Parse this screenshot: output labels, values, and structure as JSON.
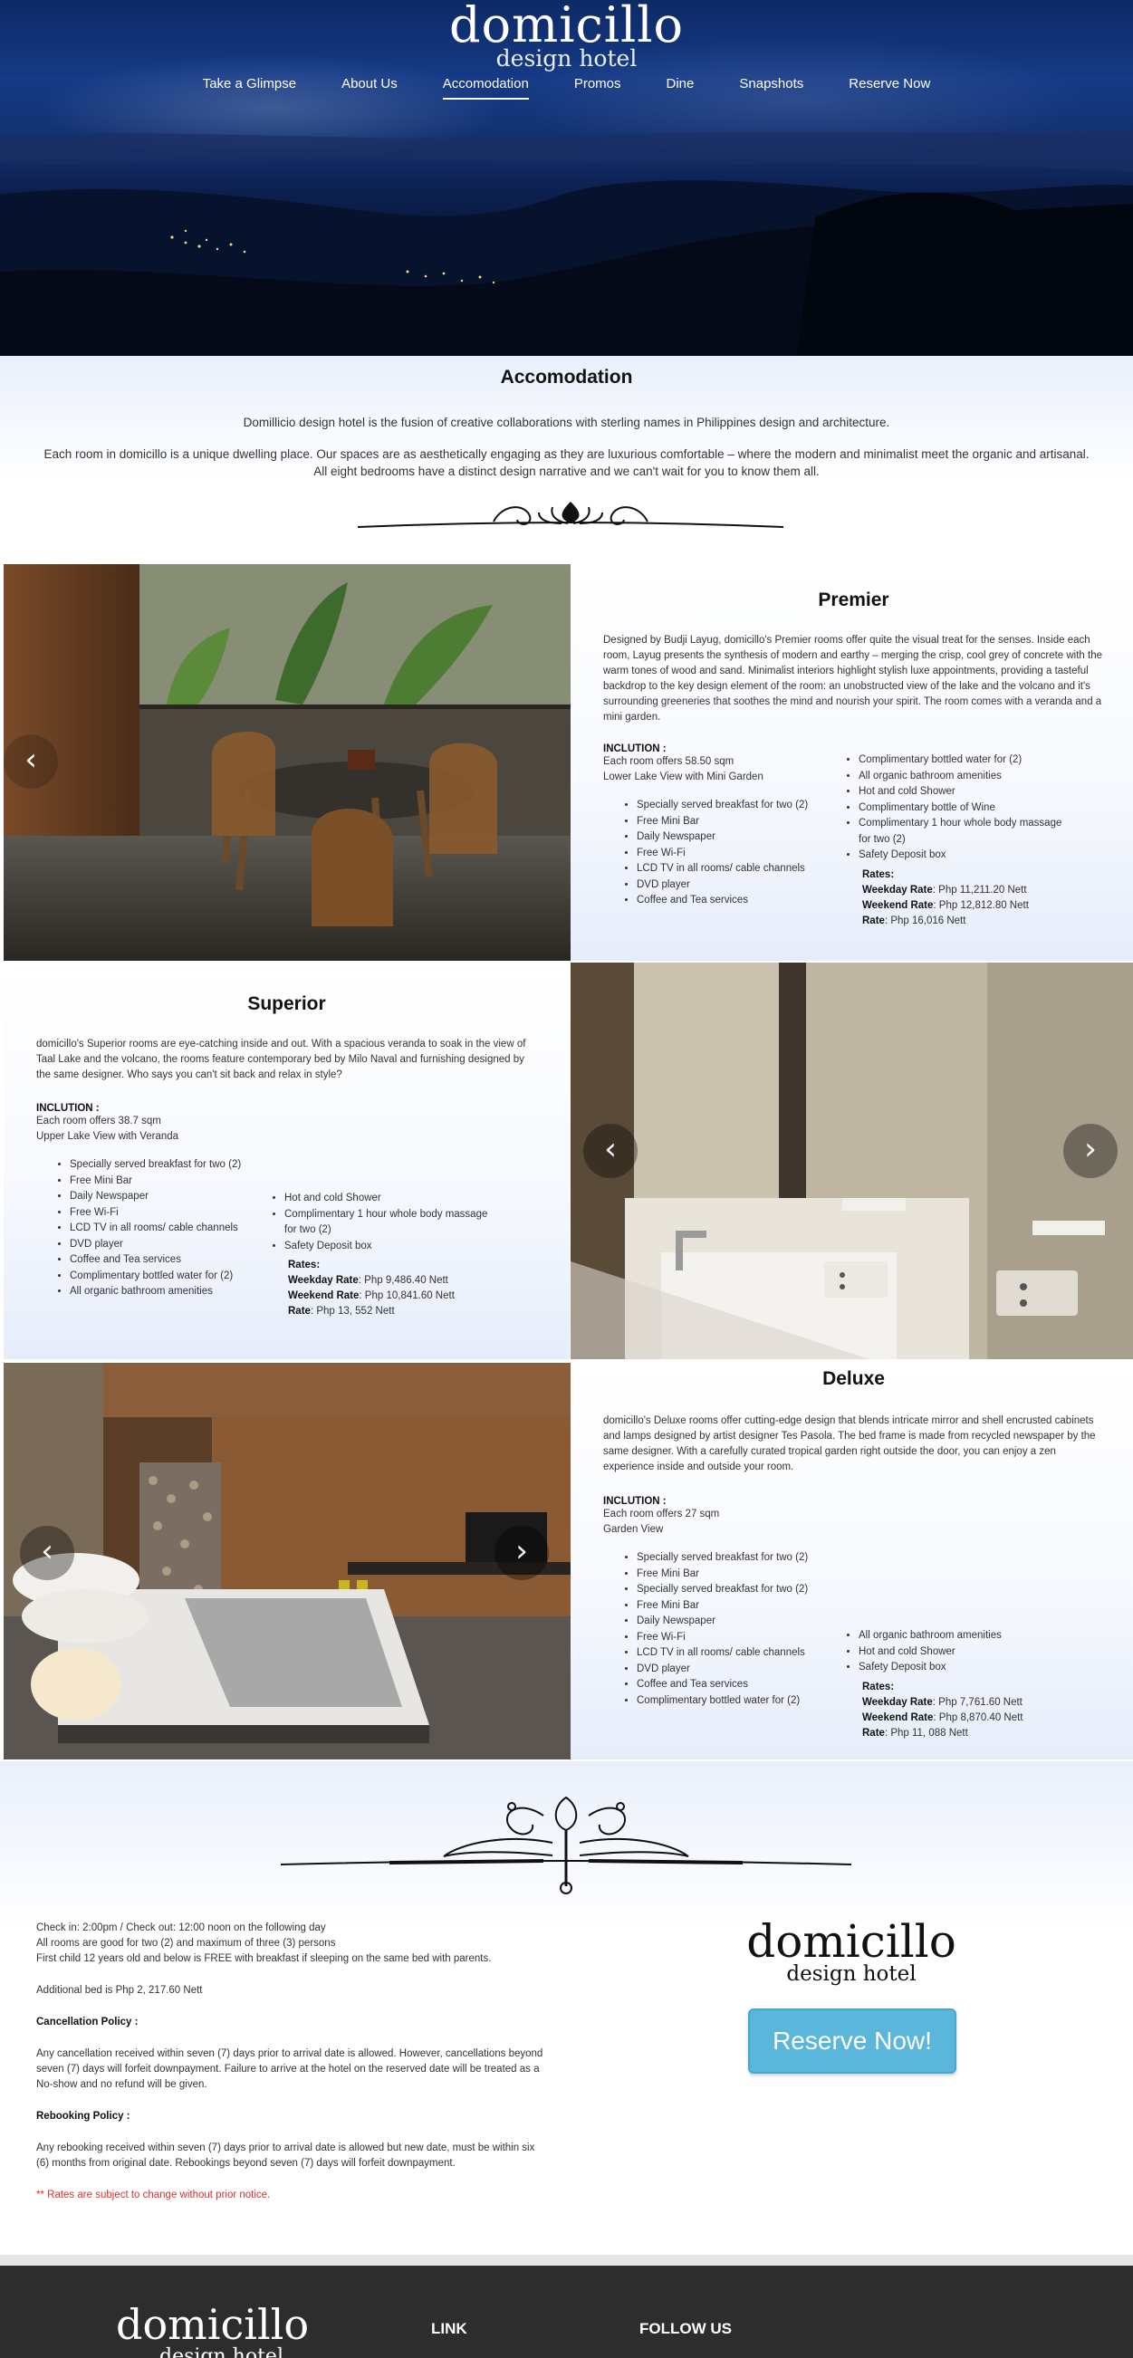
{
  "brand": {
    "name": "domicillo",
    "subtitle": "design hotel"
  },
  "nav": [
    "Take a Glimpse",
    "About Us",
    "Accomodation",
    "Promos",
    "Dine",
    "Snapshots",
    "Reserve Now"
  ],
  "nav_active": "Accomodation",
  "intro": {
    "title": "Accomodation",
    "p1": "Domillicio design hotel is the fusion of creative collaborations with sterling names in Philippines design and architecture.",
    "p2a": "Each room in domicillo is a unique dwelling place. Our spaces are as aesthetically engaging as they are luxurious comfortable – where the modern and minimalist meet the organic and artisanal.",
    "p2b": "All eight bedrooms have a distinct design narrative and we can't wait for you to know them all."
  },
  "rooms": {
    "premier": {
      "name": "Premier",
      "description": "Designed by Budji Layug, domicillo's Premier rooms offer quite the visual treat for the senses. Inside each room, Layug presents the synthesis of modern and earthy – merging the crisp, cool grey of concrete with the warm tones of wood and sand. Minimalist interiors highlight stylish luxe appointments, providing a tasteful backdrop to the key design element of the room: an unobstructed view of the lake and the volcano and it's surrounding greeneries that soothes the mind and nourish your spirit. The room comes with a veranda and a mini garden.",
      "inclusion_label": "INCLUTION :",
      "size": "Each room offers 58.50 sqm",
      "view": "Lower Lake View with Mini Garden",
      "list_left": [
        "Specially served breakfast for two (2)",
        "Free Mini Bar",
        "Daily Newspaper",
        "Free Wi-Fi",
        "LCD TV in all rooms/ cable channels",
        "DVD player",
        "Coffee and Tea services"
      ],
      "list_right": [
        "Complimentary bottled water for (2)",
        "All organic bathroom amenities",
        "Hot and cold Shower",
        "Complimentary bottle of Wine",
        "Complimentary 1 hour whole body massage for two (2)",
        "Safety Deposit box"
      ],
      "rates_label": "Rates:",
      "weekday_label": "Weekday Rate",
      "weekday": ": Php 11,211.20 Nett",
      "weekend_label": "Weekend Rate",
      "weekend": ": Php 12,812.80 Nett",
      "rate_label": "Rate",
      "rate": ": Php 16,016 Nett"
    },
    "superior": {
      "name": "Superior",
      "description": "domicillo's Superior rooms are eye-catching inside and out. With a spacious veranda to soak in the view of Taal Lake and the volcano, the rooms feature contemporary bed by Milo Naval and furnishing designed by the same designer. Who says you can't sit back and relax in style?",
      "inclusion_label": "INCLUTION :",
      "size": "Each room offers 38.7 sqm",
      "view": "Upper Lake View with Veranda",
      "list_left": [
        "Specially served breakfast for two (2)",
        "Free Mini Bar",
        "Daily Newspaper",
        "Free Wi-Fi",
        "LCD TV in all rooms/ cable channels",
        "DVD player",
        "Coffee and Tea services",
        "Complimentary bottled water for (2)",
        "All organic bathroom amenities"
      ],
      "list_right": [
        "Hot and cold Shower",
        "Complimentary 1 hour whole body massage for two (2)",
        "Safety Deposit box"
      ],
      "rates_label": "Rates:",
      "weekday_label": "Weekday Rate",
      "weekday": ": Php 9,486.40 Nett",
      "weekend_label": "Weekend Rate",
      "weekend": ": Php 10,841.60 Nett",
      "rate_label": "Rate",
      "rate": ": Php 13, 552 Nett"
    },
    "deluxe": {
      "name": "Deluxe",
      "description": "domicillo's Deluxe rooms offer cutting-edge design that blends intricate mirror and shell encrusted cabinets and lamps designed by artist designer Tes Pasola. The bed frame is made from recycled newspaper by the same designer. With a carefully curated tropical garden right outside the door, you can enjoy a zen experience inside and outside your room.",
      "inclusion_label": "INCLUTION :",
      "size": "Each room offers 27 sqm",
      "view": "Garden View",
      "list_left": [
        "Specially served breakfast for two (2)",
        "Free Mini Bar",
        "Specially served breakfast for two (2)",
        "Free Mini Bar",
        "Daily Newspaper",
        "Free Wi-Fi",
        "LCD TV in all rooms/ cable channels",
        "DVD player",
        "Coffee and Tea services",
        "Complimentary bottled water for (2)"
      ],
      "list_right": [
        "All organic bathroom amenities",
        "Hot and cold Shower",
        "Safety Deposit box"
      ],
      "rates_label": "Rates:",
      "weekday_label": "Weekday Rate",
      "weekday": ": Php 7,761.60 Nett",
      "weekend_label": "Weekend Rate",
      "weekend": ": Php 8,870.40 Nett",
      "rate_label": "Rate",
      "rate": ": Php 11, 088 Nett"
    }
  },
  "policies": {
    "l1": "Check in: 2:00pm / Check out: 12:00 noon on the following day",
    "l2": "All rooms are good for two (2) and maximum of three (3) persons",
    "l3": "First child 12 years old and below is FREE with breakfast if sleeping on the same bed with parents.",
    "l4": "Additional bed is Php 2, 217.60 Nett",
    "cancel_title": "Cancellation Policy :",
    "cancel_text": "Any cancellation received within seven (7) days prior to arrival date is allowed. However, cancellations beyond seven (7) days will forfeit downpayment. Failure to arrive at the hotel on the reserved date will be treated as a No-show and no refund will be given.",
    "rebook_title": "Rebooking Policy :",
    "rebook_text": "Any rebooking received within seven (7) days prior to arrival date is allowed but new date, must be within six (6) months from original date. Rebookings beyond seven (7) days will forfeit downpayment.",
    "note": "** Rates are subject to change without prior notice."
  },
  "reserve_button": "Reserve Now!",
  "footer": {
    "logo": "domicillo",
    "logo_sub": "design hotel",
    "link": "LINK",
    "follow": "FOLLOW US"
  },
  "icons": {
    "prev": "chevron-left-icon",
    "next": "chevron-right-icon"
  },
  "colors": {
    "reserve_button": "#5bb6dc",
    "note": "#d9302e",
    "footer": "#2d2d2d"
  }
}
